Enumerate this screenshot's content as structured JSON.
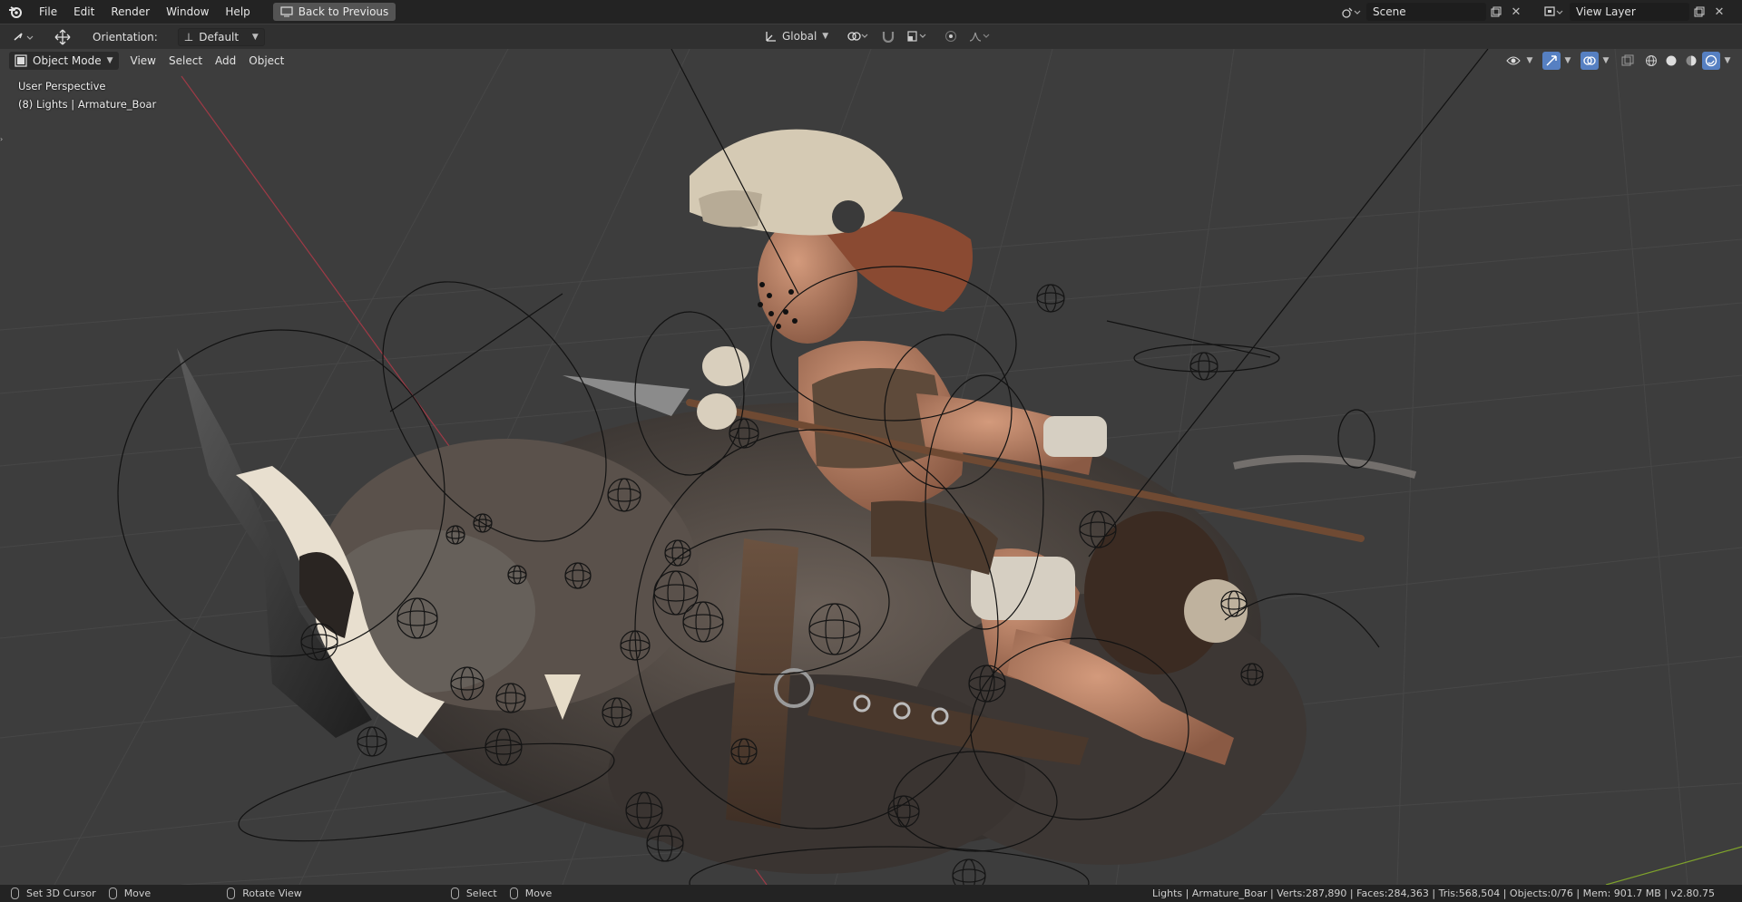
{
  "topbar": {
    "menus": [
      "File",
      "Edit",
      "Render",
      "Window",
      "Help"
    ],
    "back_button": "Back to Previous",
    "scene_name": "Scene",
    "view_layer_name": "View Layer"
  },
  "toolheader": {
    "orientation_label": "Orientation:",
    "orientation_value": "Default",
    "transform_space": "Global"
  },
  "viewheader": {
    "mode": "Object Mode",
    "menus": [
      "View",
      "Select",
      "Add",
      "Object"
    ]
  },
  "viewport": {
    "perspective": "User Perspective",
    "collection_info": "(8) Lights | Armature_Boar"
  },
  "statusbar": {
    "left": [
      "Set 3D Cursor",
      "Move",
      "Rotate View",
      "Select",
      "Move"
    ],
    "right": "Lights | Armature_Boar | Verts:287,890 | Faces:284,363 | Tris:568,504 | Objects:0/76 | Mem: 901.7 MB | v2.80.75"
  },
  "colors": {
    "accent": "#5680c2",
    "topbar_bg": "#232323",
    "header_bg": "#303030",
    "viewport_bg": "#3d3d3d",
    "x_axis": "#9e3a46",
    "y_axis": "#7fa32b"
  }
}
